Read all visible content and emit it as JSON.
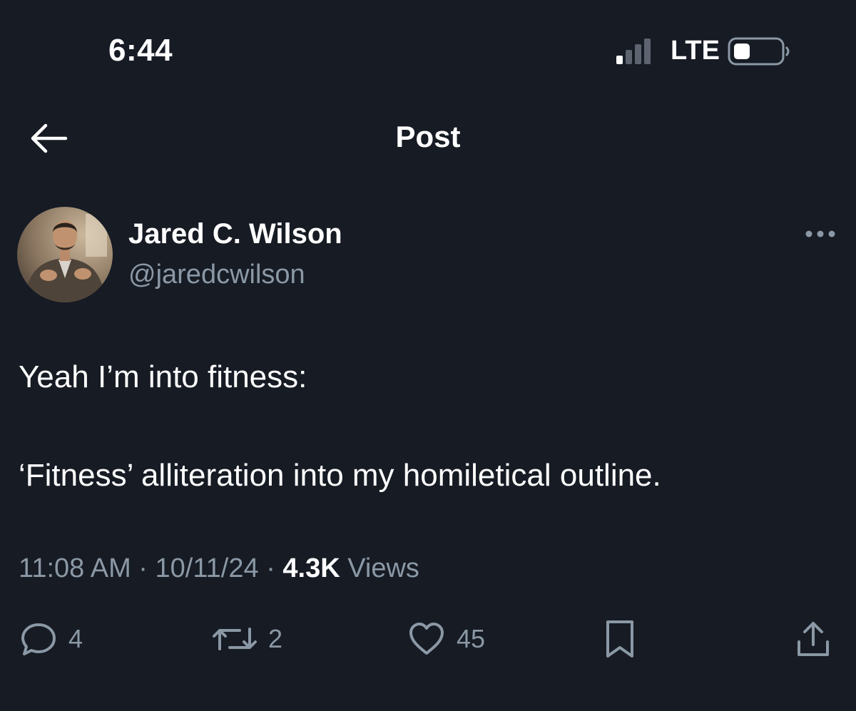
{
  "status_bar": {
    "time": "6:44",
    "network": "LTE",
    "signal_icon": "cellular-signal-icon",
    "battery_icon": "battery-icon"
  },
  "header": {
    "title": "Post",
    "back_icon": "arrow-left-icon"
  },
  "author": {
    "name": "Jared C. Wilson",
    "handle": "@jaredcwilson",
    "more_icon": "more-horizontal-icon"
  },
  "post": {
    "lines": [
      "Yeah I’m into fitness:",
      "‘Fitness’ alliteration into my homiletical outline."
    ]
  },
  "meta": {
    "time": "11:08 AM",
    "date": "10/11/24",
    "separator": "·",
    "views_count": "4.3K",
    "views_label": "Views"
  },
  "actions": {
    "replies": "4",
    "reposts": "2",
    "likes": "45"
  },
  "colors": {
    "background": "#161b24",
    "text_primary": "#ffffff",
    "text_secondary": "#8b98a5"
  }
}
